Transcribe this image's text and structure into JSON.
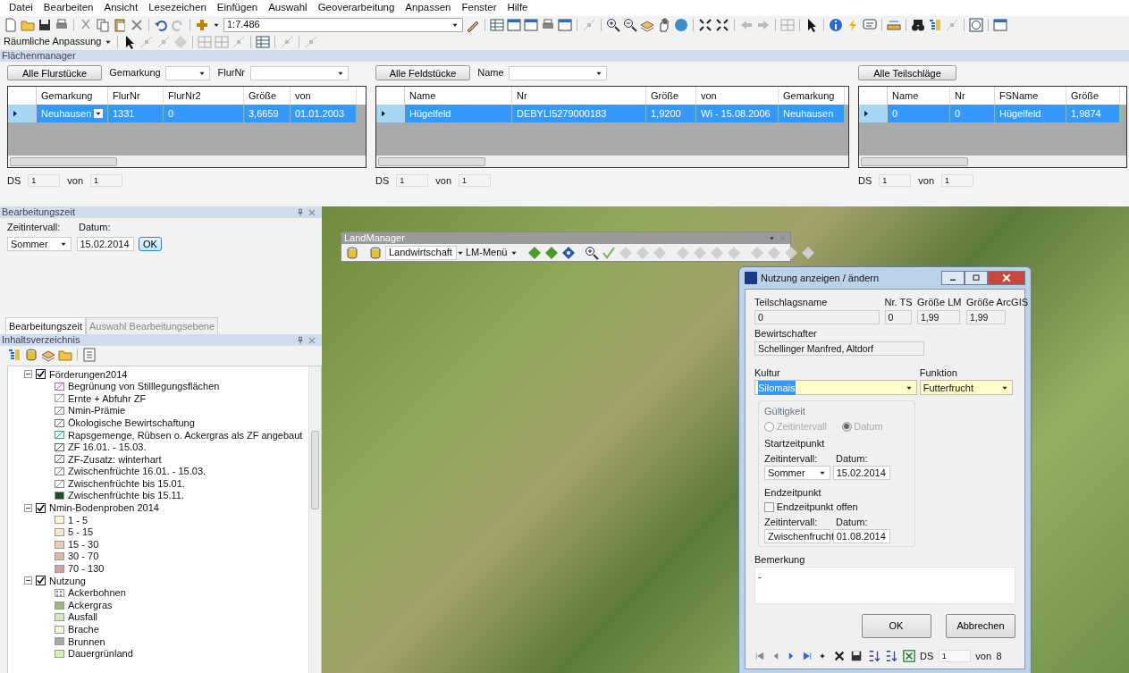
{
  "menu_bar": [
    "Datei",
    "Bearbeiten",
    "Ansicht",
    "Lesezeichen",
    "Einfügen",
    "Auswahl",
    "Geoverarbeitung",
    "Anpassen",
    "Fenster",
    "Hilfe"
  ],
  "toolbar": {
    "scale": "1:7.486"
  },
  "toolbar_2": {
    "menu": "Räumliche Anpassung"
  },
  "area_manager": {
    "title": "Flächenmanager",
    "panels": [
      {
        "kind": "editable",
        "button": "Alle Flurstücke",
        "filters": [
          {
            "label": "Gemarkung"
          },
          {
            "label": "FlurNr"
          }
        ],
        "columns": [
          "Gemarkung",
          "FlurNr",
          "FlurNr2",
          "Größe",
          "von"
        ],
        "rows": [
          {
            "selected": true,
            "cells": [
              "Neuhausen",
              "1331",
              "0",
              "3,6659",
              "01.01.2003"
            ]
          }
        ],
        "ds_label": "DS",
        "ds_value": "1",
        "of_label": "von",
        "of_value": "1"
      },
      {
        "kind": "plain",
        "button": "Alle Feldstücke",
        "filters": [
          {
            "label": "Name"
          }
        ],
        "columns": [
          "Name",
          "Nr",
          "Größe",
          "von",
          "Gemarkung"
        ],
        "rows": [
          {
            "selected": true,
            "cells": [
              "Hügelfeld",
              "DEBYLI5279000183",
              "1,9200",
              "Wi - 15.08.2006",
              "Neuhausen"
            ]
          }
        ],
        "ds_label": "DS",
        "ds_value": "1",
        "of_label": "von",
        "of_value": "1"
      },
      {
        "kind": "plain",
        "button": "Alle Teilschläge",
        "columns": [
          "Name",
          "Nr",
          "FSName",
          "Größe"
        ],
        "rows": [
          {
            "selected": true,
            "cells": [
              "0",
              "0",
              "Hügelfeld",
              "1,9874"
            ]
          }
        ],
        "ds_label": "DS",
        "ds_value": "1",
        "of_label": "von",
        "of_value": "1"
      }
    ]
  },
  "edit_time": {
    "title": "Bearbeitungszeit",
    "interval_label": "Zeitintervall:",
    "date_label": "Datum:",
    "interval": "Sommer",
    "date": "15.02.2014",
    "ok": "OK",
    "tabs": [
      {
        "label": "Bearbeitungszeit",
        "selected": true
      },
      {
        "label": "Auswahl Bearbeitungsebene",
        "selected": false
      }
    ]
  },
  "toc": {
    "title": "Inhaltsverzeichnis",
    "layers": [
      {
        "label": "Förderungen2014",
        "checked": true,
        "expanded": true,
        "children": [
          {
            "label": "Begrünung von Stilllegungsflächen",
            "kind": "hatched",
            "color": "#a070b0"
          },
          {
            "label": "Ernte + Abfuhr ZF",
            "kind": "hatched",
            "color": "#90b060"
          },
          {
            "label": "Nmin-Prämie",
            "kind": "hatched",
            "color": "#50a0b0"
          },
          {
            "label": "Ökologische Bewirtschaftung",
            "kind": "hatched",
            "color": "#b06050"
          },
          {
            "label": "Rapsgemenge, Rübsen o. Ackergras als ZF angebaut",
            "kind": "hatched",
            "color": "#40a080"
          },
          {
            "label": "ZF 16.01. - 15.03.",
            "kind": "hatched",
            "color": "#606060"
          },
          {
            "label": "ZF-Zusatz: winterhart",
            "kind": "hatched",
            "color": "#807070"
          },
          {
            "label": "Zwischenfrüchte 16.01. - 15.03.",
            "kind": "hatched",
            "color": "#60a040"
          },
          {
            "label": "Zwischenfrüchte bis 15.01.",
            "kind": "hatched",
            "color": "#a08060"
          },
          {
            "label": "Zwischenfrüchte bis 15.11.",
            "kind": "solid",
            "color": "#1e4d2b"
          }
        ]
      },
      {
        "label": "Nmin-Bodenproben 2014",
        "checked": true,
        "expanded": true,
        "children": [
          {
            "label": "1 - 5",
            "kind": "solid",
            "color": "#fdf8dc"
          },
          {
            "label": "5 - 15",
            "kind": "solid",
            "color": "#f5e6cc"
          },
          {
            "label": "15 - 30",
            "kind": "solid",
            "color": "#e8cdb8"
          },
          {
            "label": "30 - 70",
            "kind": "solid",
            "color": "#ddb8a8"
          },
          {
            "label": "70 - 130",
            "kind": "solid",
            "color": "#d4a0a0"
          }
        ]
      },
      {
        "label": "Nutzung",
        "checked": true,
        "expanded": true,
        "children": [
          {
            "label": "Ackerbohnen",
            "kind": "dotted",
            "color": "#f4f4f4"
          },
          {
            "label": "Ackergras",
            "kind": "solid",
            "color": "#9cb87a"
          },
          {
            "label": "Ausfall",
            "kind": "solid",
            "color": "#d6e4c0"
          },
          {
            "label": "Brache",
            "kind": "solid",
            "color": "#faf2d4"
          },
          {
            "label": "Brunnen",
            "kind": "solid",
            "color": "#a8a8a8"
          },
          {
            "label": "Dauergrünland",
            "kind": "solid",
            "color": "#d8f0b0"
          }
        ]
      }
    ]
  },
  "landmanager": {
    "title": "LandManager",
    "domain": "Landwirtschaft",
    "menu": "LM-Menü"
  },
  "dialog": {
    "title": "Nutzung anzeigen / ändern",
    "name_label": "Teilschlagsname",
    "name": "0",
    "nr_label": "Nr. TS",
    "nr": "0",
    "size_lm_label": "Größe LM",
    "size_lm": "1,99",
    "size_gis_label": "Größe ArcGIS",
    "size_gis": "1,99",
    "farmer_label": "Bewirtschafter",
    "farmer": "Schellinger Manfred, Altdorf",
    "crop_label": "Kultur",
    "crop": "Silomais",
    "function_label": "Funktion",
    "function": "Futterfrucht",
    "validity": {
      "title": "Gültigkeit",
      "modes": [
        {
          "label": "Zeitintervall",
          "selected": false,
          "disabled": true
        },
        {
          "label": "Datum",
          "selected": true,
          "disabled": true
        }
      ],
      "start_title": "Startzeitpunkt",
      "start_interval_label": "Zeitintervall:",
      "start_date_label": "Datum:",
      "start_interval": "Sommer",
      "start_date": "15.02.2014",
      "end_title": "Endzeitpunkt",
      "open_end": {
        "label": "Endzeitpunkt offen",
        "checked": false
      },
      "end_interval_label": "Zeitintervall:",
      "end_date_label": "Datum:",
      "end_interval": "Zwischenfrucht",
      "end_date": "01.08.2014"
    },
    "remark_label": "Bemerkung",
    "remark": "-",
    "ok": "OK",
    "cancel": "Abbrechen",
    "ds_label": "DS",
    "ds_value": "1",
    "of_label": "von",
    "of_value": "8"
  }
}
